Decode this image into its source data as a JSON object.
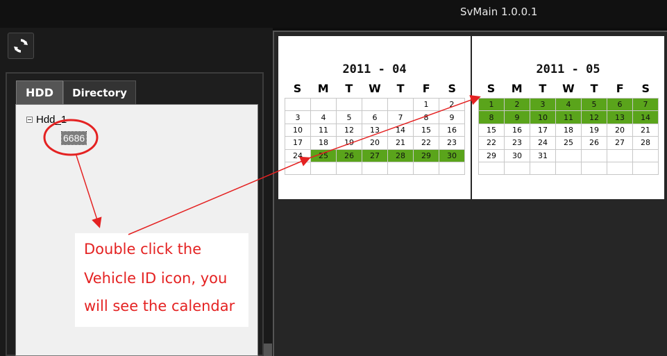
{
  "window": {
    "title": "SvMain 1.0.0.1"
  },
  "toolbar": {
    "refresh_icon": "refresh-icon"
  },
  "tabs": [
    {
      "label": "HDD",
      "active": true
    },
    {
      "label": "Directory",
      "active": false
    }
  ],
  "tree": {
    "root_label": "Hdd_1",
    "vehicle_label": "6686"
  },
  "calendars": [
    {
      "title": "2011 - 04",
      "weekdays": [
        "S",
        "M",
        "T",
        "W",
        "T",
        "F",
        "S"
      ],
      "cells": [
        "",
        "",
        "",
        "",
        "",
        "1",
        "2",
        "3",
        "4",
        "5",
        "6",
        "7",
        "8",
        "9",
        "10",
        "11",
        "12",
        "13",
        "14",
        "15",
        "16",
        "17",
        "18",
        "19",
        "20",
        "21",
        "22",
        "23",
        "24",
        "25",
        "26",
        "27",
        "28",
        "29",
        "30",
        "",
        "",
        "",
        "",
        "",
        "",
        ""
      ],
      "recorded_days": [
        "25",
        "26",
        "27",
        "28",
        "29",
        "30"
      ]
    },
    {
      "title": "2011 - 05",
      "weekdays": [
        "S",
        "M",
        "T",
        "W",
        "T",
        "F",
        "S"
      ],
      "cells": [
        "1",
        "2",
        "3",
        "4",
        "5",
        "6",
        "7",
        "8",
        "9",
        "10",
        "11",
        "12",
        "13",
        "14",
        "15",
        "16",
        "17",
        "18",
        "19",
        "20",
        "21",
        "22",
        "23",
        "24",
        "25",
        "26",
        "27",
        "28",
        "29",
        "30",
        "31",
        "",
        "",
        "",
        "",
        "",
        "",
        "",
        "",
        "",
        "",
        ""
      ],
      "recorded_days": [
        "1",
        "2",
        "3",
        "4",
        "5",
        "6",
        "7",
        "8",
        "9",
        "10",
        "11",
        "12",
        "13",
        "14"
      ]
    }
  ],
  "annotation": {
    "lines": [
      "Double click the",
      "Vehicle ID icon, you",
      "will see the calendar"
    ]
  },
  "colors": {
    "recorded_day": "#5aa41b",
    "annotation": "#e42222"
  }
}
